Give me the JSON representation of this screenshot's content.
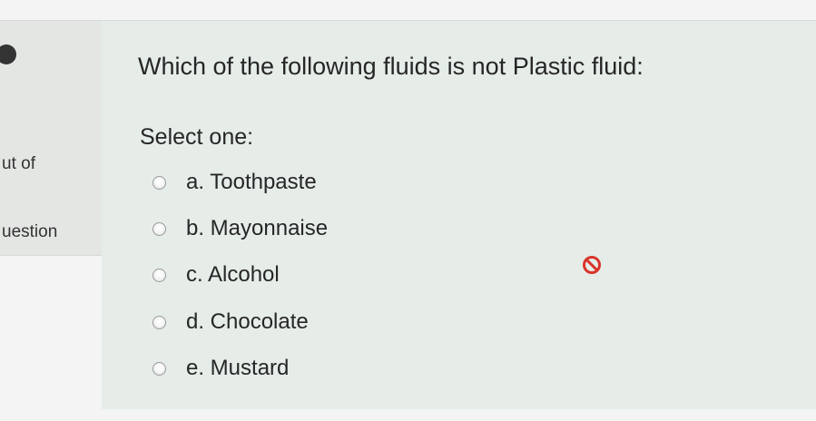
{
  "sidebar": {
    "out_of_text": "ut of",
    "question_text": "uestion"
  },
  "question": {
    "text": "Which of the following fluids is not Plastic fluid:",
    "prompt": "Select one:",
    "options": [
      {
        "label": "a. Toothpaste"
      },
      {
        "label": "b. Mayonnaise"
      },
      {
        "label": "c. Alcohol"
      },
      {
        "label": "d. Chocolate"
      },
      {
        "label": "e. Mustard"
      }
    ],
    "feedback_icon": "incorrect-icon",
    "feedback_color": "#d9352b"
  }
}
